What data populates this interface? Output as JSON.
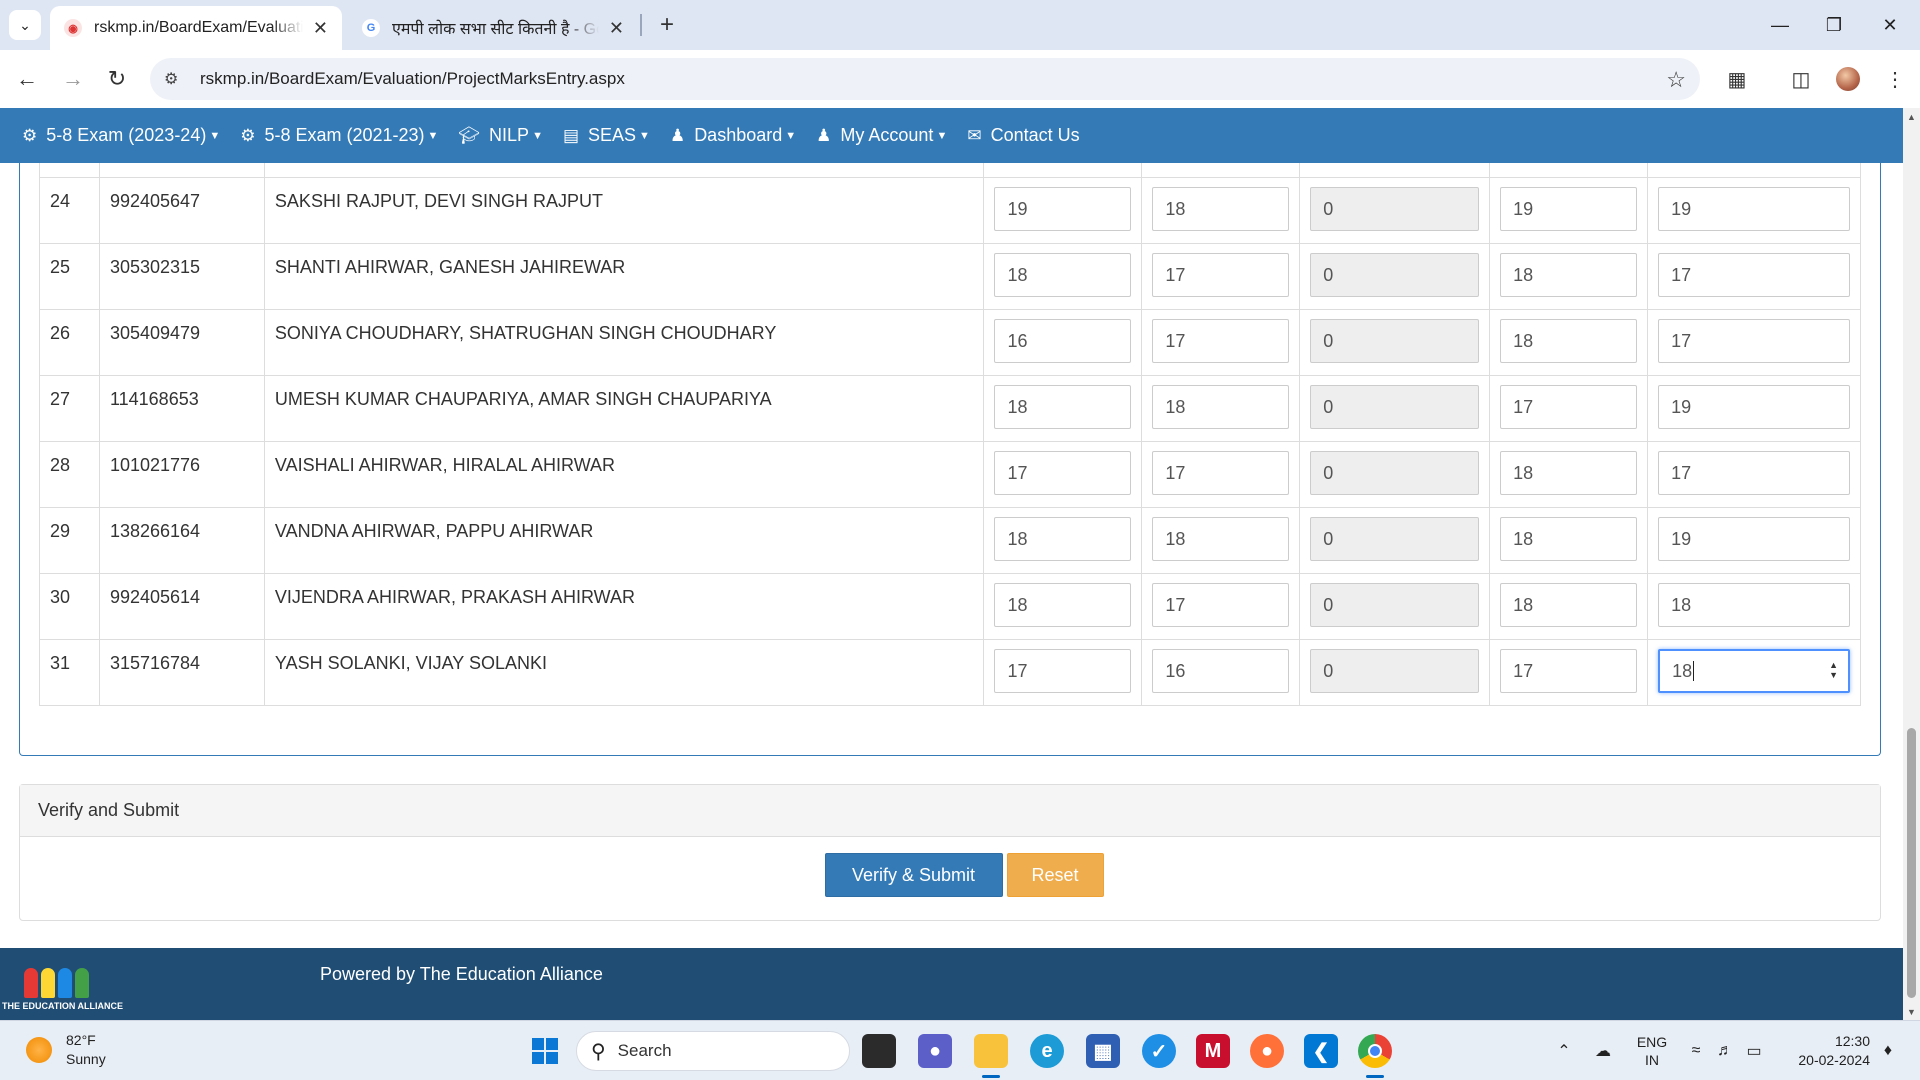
{
  "browser": {
    "tabs": [
      {
        "title": "rskmp.in/BoardExam/Evaluation",
        "active": true
      },
      {
        "title": "एमपी लोक सभा सीट कितनी है - Google",
        "active": false
      }
    ],
    "url": "rskmp.in/BoardExam/Evaluation/ProjectMarksEntry.aspx"
  },
  "navbar": {
    "items": [
      {
        "label": "5-8 Exam (2023-24)",
        "icon": "gear-icon"
      },
      {
        "label": "5-8 Exam (2021-23)",
        "icon": "gear-icon"
      },
      {
        "label": "NILP",
        "icon": "graduation-cap-icon"
      },
      {
        "label": "SEAS",
        "icon": "book-icon"
      },
      {
        "label": "Dashboard",
        "icon": "user-icon"
      },
      {
        "label": "My Account",
        "icon": "user-icon"
      },
      {
        "label": "Contact Us",
        "icon": "envelope-icon"
      }
    ]
  },
  "students": [
    {
      "sno": "24",
      "roll": "992405647",
      "name": "SAKSHI RAJPUT, DEVI SINGH RAJPUT",
      "marks": [
        "19",
        "18",
        "0",
        "19",
        "19"
      ]
    },
    {
      "sno": "25",
      "roll": "305302315",
      "name": "SHANTI AHIRWAR, GANESH JAHIREWAR",
      "marks": [
        "18",
        "17",
        "0",
        "18",
        "17"
      ]
    },
    {
      "sno": "26",
      "roll": "305409479",
      "name": "SONIYA CHOUDHARY, SHATRUGHAN SINGH CHOUDHARY",
      "marks": [
        "16",
        "17",
        "0",
        "18",
        "17"
      ]
    },
    {
      "sno": "27",
      "roll": "114168653",
      "name": "UMESH KUMAR CHAUPARIYA, AMAR SINGH CHAUPARIYA",
      "marks": [
        "18",
        "18",
        "0",
        "17",
        "19"
      ]
    },
    {
      "sno": "28",
      "roll": "101021776",
      "name": "VAISHALI AHIRWAR, HIRALAL AHIRWAR",
      "marks": [
        "17",
        "17",
        "0",
        "18",
        "17"
      ]
    },
    {
      "sno": "29",
      "roll": "138266164",
      "name": "VANDNA AHIRWAR, PAPPU AHIRWAR",
      "marks": [
        "18",
        "18",
        "0",
        "18",
        "19"
      ]
    },
    {
      "sno": "30",
      "roll": "992405614",
      "name": "VIJENDRA AHIRWAR, PRAKASH AHIRWAR",
      "marks": [
        "18",
        "17",
        "0",
        "18",
        "18"
      ]
    },
    {
      "sno": "31",
      "roll": "315716784",
      "name": "YASH SOLANKI, VIJAY SOLANKI",
      "marks": [
        "17",
        "16",
        "0",
        "17",
        "18"
      ]
    }
  ],
  "verify_panel": {
    "heading": "Verify and Submit",
    "submit_label": "Verify & Submit",
    "reset_label": "Reset"
  },
  "footer": {
    "logo_text": "THE EDUCATION ALLIANCE",
    "powered_by": "Powered by The Education Alliance"
  },
  "taskbar": {
    "weather_temp": "82°F",
    "weather_desc": "Sunny",
    "search_label": "Search",
    "lang_1": "ENG",
    "lang_2": "IN",
    "time": "12:30",
    "date": "20-02-2024"
  },
  "colors": {
    "navbar": "#337ab7",
    "footer": "#204d74",
    "primary_button": "#337ab7",
    "warning_button": "#f0ad4e"
  }
}
